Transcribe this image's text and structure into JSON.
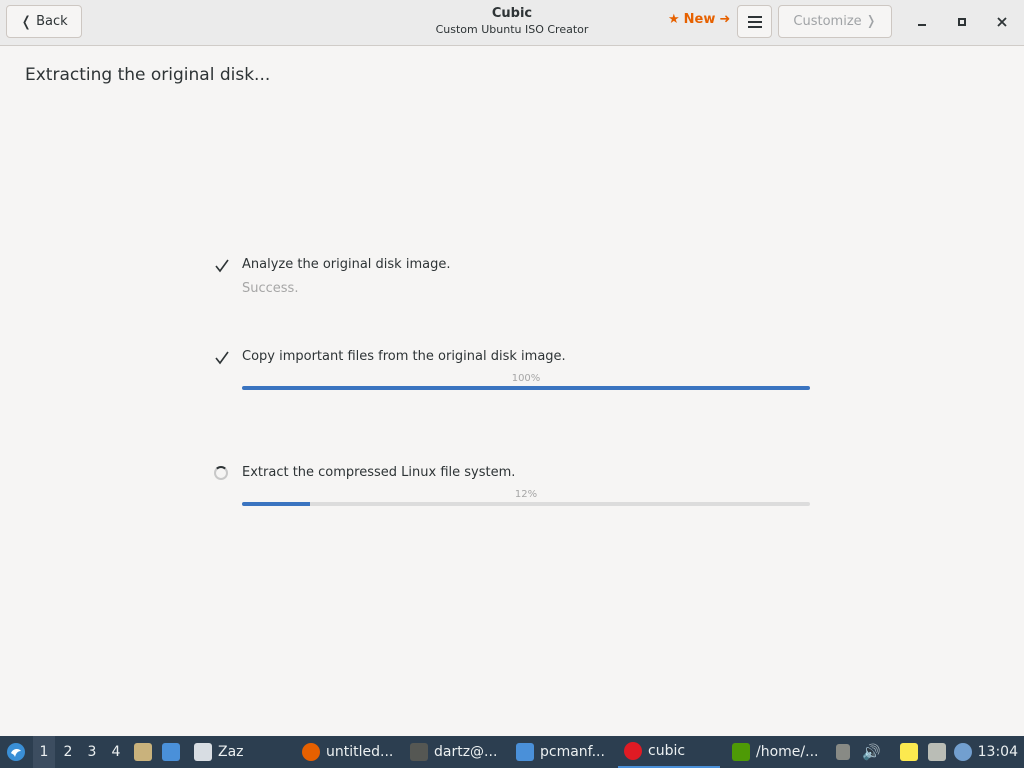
{
  "header": {
    "back_label": "Back",
    "title": "Cubic",
    "subtitle": "Custom Ubuntu ISO Creator",
    "new_label": "New",
    "customize_label": "Customize"
  },
  "content": {
    "page_title": "Extracting the original disk...",
    "steps": [
      {
        "label": "Analyze the original disk image.",
        "status": "Success."
      },
      {
        "label": "Copy important files from the original disk image.",
        "progress_text": "100%",
        "progress": 1.0
      },
      {
        "label": "Extract the compressed Linux file system.",
        "progress_text": "12%",
        "progress": 0.12
      }
    ]
  },
  "taskbar": {
    "workspaces": [
      "1",
      "2",
      "3",
      "4"
    ],
    "tasks": [
      {
        "label": "Zaz",
        "icon": "window-icon"
      },
      {
        "label": "untitled...",
        "icon": "firefox-icon"
      },
      {
        "label": "dartz@...",
        "icon": "terminal-icon"
      },
      {
        "label": "pcmanf...",
        "icon": "folder-icon"
      },
      {
        "label": "cubic",
        "icon": "cubic-icon"
      },
      {
        "label": "/home/...",
        "icon": "archive-icon"
      }
    ],
    "clock": "13:04"
  },
  "colors": {
    "accent": "#3a74c0",
    "new_button": "#e66100",
    "taskbar_bg": "#2c3e50"
  }
}
